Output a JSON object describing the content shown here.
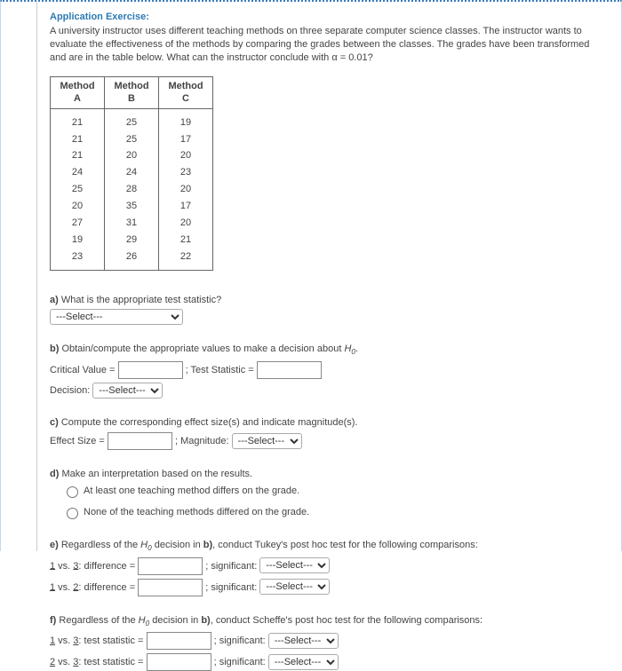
{
  "title": "Application Exercise:",
  "prompt_text": "A university instructor uses different teaching methods on three separate computer science classes.  The instructor wants to evaluate the effectiveness of the methods by comparing the grades between the classes.  The grades have been transformed and are in the table below.  What can the instructor conclude with α = 0.01?",
  "table": {
    "headers": [
      {
        "line1": "Method",
        "line2": "A"
      },
      {
        "line1": "Method",
        "line2": "B"
      },
      {
        "line1": "Method",
        "line2": "C"
      }
    ],
    "rows": [
      [
        "21",
        "25",
        "19"
      ],
      [
        "21",
        "25",
        "17"
      ],
      [
        "21",
        "20",
        "20"
      ],
      [
        "24",
        "24",
        "23"
      ],
      [
        "25",
        "28",
        "20"
      ],
      [
        "20",
        "35",
        "17"
      ],
      [
        "27",
        "31",
        "20"
      ],
      [
        "19",
        "29",
        "21"
      ],
      [
        "23",
        "26",
        "22"
      ]
    ]
  },
  "a": {
    "label": "a)",
    "question": "What is the appropriate test statistic?",
    "select": "---Select---"
  },
  "b": {
    "label": "b)",
    "question_prefix": "Obtain/compute the appropriate values to make a decision about ",
    "h0": "H",
    "h0_sub": "0",
    "question_suffix": ".",
    "crit_label": "Critical Value = ",
    "test_stat_label": ";  Test Statistic = ",
    "decision_label": "Decision:  ",
    "decision_select": "---Select---"
  },
  "c": {
    "label": "c)",
    "question": "Compute the corresponding effect size(s) and indicate magnitude(s).",
    "effect_label": "Effect Size = ",
    "mag_label": ";  Magnitude:  ",
    "mag_select": "---Select---"
  },
  "d": {
    "label": "d)",
    "question": "Make an interpretation based on the results.",
    "options": [
      "At least one teaching method differs on the grade.",
      "None of the teaching methods differed on the grade."
    ]
  },
  "e": {
    "label": "e)",
    "question_prefix": "Regardless of the ",
    "h0": "H",
    "h0_sub": "0",
    "question_mid": " decision in ",
    "bold_b": "b)",
    "question_suffix": ", conduct Tukey's post hoc test for the following comparisons:",
    "rows": [
      {
        "u1": "1",
        "sep": " vs. ",
        "u2": "3",
        "diff": ": difference = ",
        "sig_label": ";  significant:  ",
        "select": "---Select---"
      },
      {
        "u1": "1",
        "sep": " vs. ",
        "u2": "2",
        "diff": ": difference = ",
        "sig_label": ";  significant:  ",
        "select": "---Select---"
      }
    ]
  },
  "f": {
    "label": "f)",
    "question_prefix": "Regardless of the ",
    "h0": "H",
    "h0_sub": "0",
    "question_mid": " decision in ",
    "bold_b": "b)",
    "question_suffix": ", conduct Scheffe's post hoc test for the following comparisons:",
    "rows": [
      {
        "u1": "1",
        "sep": " vs. ",
        "u2": "3",
        "stat": ": test statistic = ",
        "sig_label": ";  significant:  ",
        "select": "---Select---"
      },
      {
        "u1": "2",
        "sep": " vs. ",
        "u2": "3",
        "stat": ": test statistic = ",
        "sig_label": ";  significant:  ",
        "select": "---Select---"
      }
    ]
  }
}
